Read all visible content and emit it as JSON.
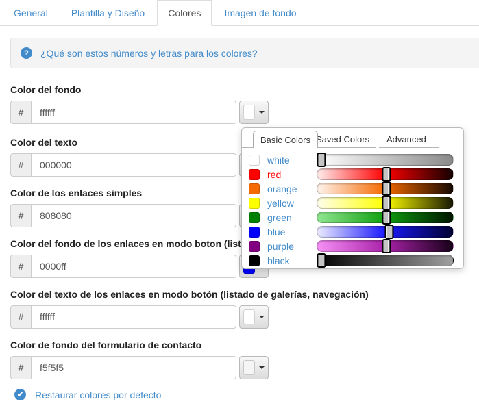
{
  "tabs": {
    "items": [
      {
        "label": "General",
        "active": false
      },
      {
        "label": "Plantilla y Diseño",
        "active": false
      },
      {
        "label": "Colores",
        "active": true
      },
      {
        "label": "Imagen de fondo",
        "active": false
      }
    ]
  },
  "alert": {
    "icon_glyph": "?",
    "text": "¿Qué son estos números y letras para los colores?"
  },
  "hash_prefix": "#",
  "fields": [
    {
      "label": "Color del fondo",
      "value": "ffffff",
      "swatch": "#ffffff"
    },
    {
      "label": "Color del texto",
      "value": "000000",
      "swatch": "#000000"
    },
    {
      "label": "Color de los enlaces simples",
      "value": "808080",
      "swatch": "#808080"
    },
    {
      "label": "Color del fondo de los enlaces en modo boton (listado de galerías, navegación)",
      "value": "0000ff",
      "swatch": "#0000ff"
    },
    {
      "label": "Color del texto de los enlaces en modo botón (listado de galerías, navegación)",
      "value": "ffffff",
      "swatch": "#ffffff"
    },
    {
      "label": "Color de fondo del formulario de contacto",
      "value": "f5f5f5",
      "swatch": "#f5f5f5"
    }
  ],
  "picker": {
    "tabs": [
      {
        "label": "Basic Colors",
        "active": true
      },
      {
        "label": "Saved Colors",
        "active": false
      },
      {
        "label": "Advanced",
        "active": false
      }
    ],
    "colors": [
      {
        "name": "white",
        "hex": "#ffffff",
        "label_color": "#428bca",
        "gradient": "linear-gradient(to right, #ffffff, #8a8a8a)",
        "handle_left": "3%"
      },
      {
        "name": "red",
        "hex": "#ff0000",
        "label_color": "#ff0000",
        "gradient": "linear-gradient(to right, #ffecec, #ff0000 50%, #140000)",
        "handle_left": "51%"
      },
      {
        "name": "orange",
        "hex": "#f56a00",
        "label_color": "#428bca",
        "gradient": "linear-gradient(to right, #fff3ec, #f56a00 50%, #170900)",
        "handle_left": "51%"
      },
      {
        "name": "yellow",
        "hex": "#ffff00",
        "label_color": "#428bca",
        "gradient": "linear-gradient(to right, #ffffec, #ffff00 50%, #171700)",
        "handle_left": "51%"
      },
      {
        "name": "green",
        "hex": "#008000",
        "label_color": "#428bca",
        "gradient": "linear-gradient(to right, #90e690, #0f9f0f 50%, #001400)",
        "handle_left": "51%"
      },
      {
        "name": "blue",
        "hex": "#0000ff",
        "label_color": "#428bca",
        "gradient": "linear-gradient(to right, #ececff, #1a1aff 50%, #000030)",
        "handle_left": "53%"
      },
      {
        "name": "purple",
        "hex": "#800080",
        "label_color": "#428bca",
        "gradient": "linear-gradient(to right, #f590f5, #aa22aa 50%, #170017)",
        "handle_left": "51%"
      },
      {
        "name": "black",
        "hex": "#000000",
        "label_color": "#428bca",
        "gradient": "linear-gradient(to right, #000000, #a0a0a0)",
        "handle_left": "3%"
      }
    ]
  },
  "restore": {
    "icon_glyph": "✔",
    "label": "Restaurar colores por defecto"
  }
}
